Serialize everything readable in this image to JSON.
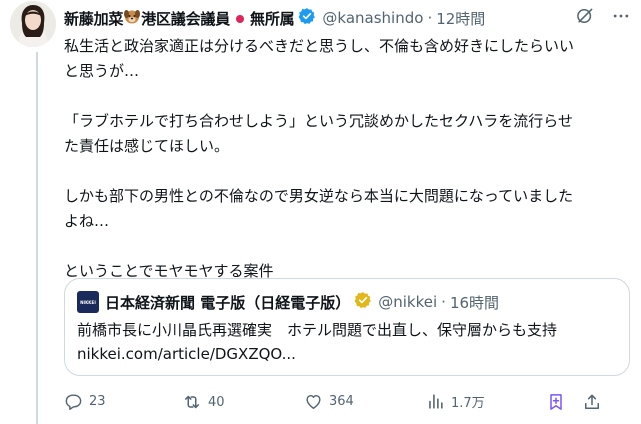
{
  "author": {
    "name_part1": "新藤加菜",
    "name_part2": "港区議会議員",
    "name_part3": "無所属",
    "handle": "@kanashindo",
    "separator": "·",
    "time": "12時間"
  },
  "tweet": {
    "lines": [
      "私生活と政治家適正は分けるべきだと思うし、不倫も含め好きにしたらいい",
      "と思うが…",
      "「ラブホテルで打ち合わせしよう」という冗談めかしたセクハラを流行らせ",
      "た責任は感じてほしい。",
      "しかも部下の男性との不倫なので男女逆なら本当に大問題になっていました",
      "よね…",
      "ということでモヤモヤする案件"
    ]
  },
  "quote": {
    "logo_text": "NIKKEI",
    "name": "日本経済新聞 電子版（日経電子版）",
    "handle": "@nikkei",
    "separator": "·",
    "time": "16時間",
    "text": "前橋市長に小川晶氏再選確実　ホテル問題で出直し、保守層からも支持",
    "link": "nikkei.com/article/DGXZQO..."
  },
  "actions": {
    "replies": "23",
    "reposts": "40",
    "likes": "364",
    "views": "1.7万"
  },
  "colors": {
    "text": "#0f1419",
    "secondary": "#536471",
    "border": "#cfd9de",
    "verified_blue": "#1d9bf0",
    "verified_gold": "#e2b719",
    "bookmark_purple": "#7856ff",
    "red_dot": "#e0245e"
  }
}
